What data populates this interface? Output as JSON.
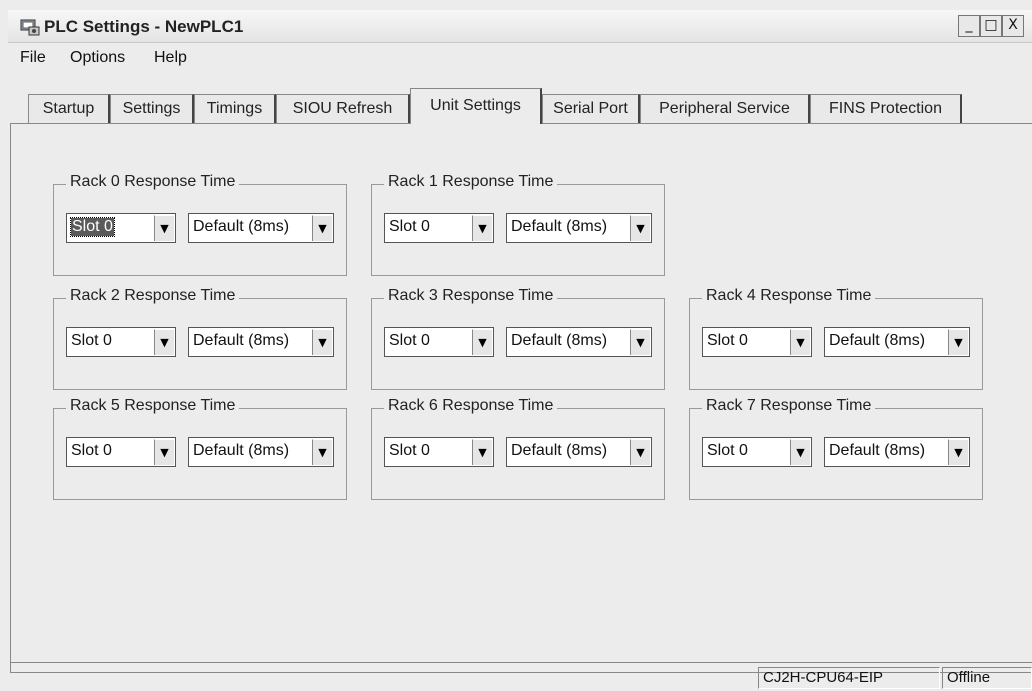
{
  "window": {
    "title": "PLC Settings - NewPLC1",
    "buttons": {
      "minimize": "_",
      "maximize": "□",
      "close": "X"
    }
  },
  "menu": [
    {
      "label": "File"
    },
    {
      "label": "Options"
    },
    {
      "label": "Help"
    }
  ],
  "tabs": [
    {
      "label": "Startup"
    },
    {
      "label": "Settings"
    },
    {
      "label": "Timings"
    },
    {
      "label": "SIOU Refresh"
    },
    {
      "label": "Unit Settings",
      "active": true
    },
    {
      "label": "Serial Port"
    },
    {
      "label": "Peripheral Service"
    },
    {
      "label": "FINS Protection"
    }
  ],
  "groups": {
    "rack0": {
      "label": "Rack 0 Response Time",
      "slot": "Slot 0",
      "time": "Default (8ms)"
    },
    "rack1": {
      "label": "Rack 1 Response Time",
      "slot": "Slot 0",
      "time": "Default (8ms)"
    },
    "rack2": {
      "label": "Rack 2 Response Time",
      "slot": "Slot 0",
      "time": "Default (8ms)"
    },
    "rack3": {
      "label": "Rack 3 Response Time",
      "slot": "Slot 0",
      "time": "Default (8ms)"
    },
    "rack4": {
      "label": "Rack 4 Response Time",
      "slot": "Slot 0",
      "time": "Default (8ms)"
    },
    "rack5": {
      "label": "Rack 5 Response Time",
      "slot": "Slot 0",
      "time": "Default (8ms)"
    },
    "rack6": {
      "label": "Rack 6 Response Time",
      "slot": "Slot 0",
      "time": "Default (8ms)"
    },
    "rack7": {
      "label": "Rack 7 Response Time",
      "slot": "Slot 0",
      "time": "Default (8ms)"
    }
  },
  "status": {
    "model": "CJ2H-CPU64-EIP",
    "mode": "Offline"
  },
  "icons": {
    "dropdown": "chevron-down-icon",
    "app": "plc-settings-icon"
  }
}
